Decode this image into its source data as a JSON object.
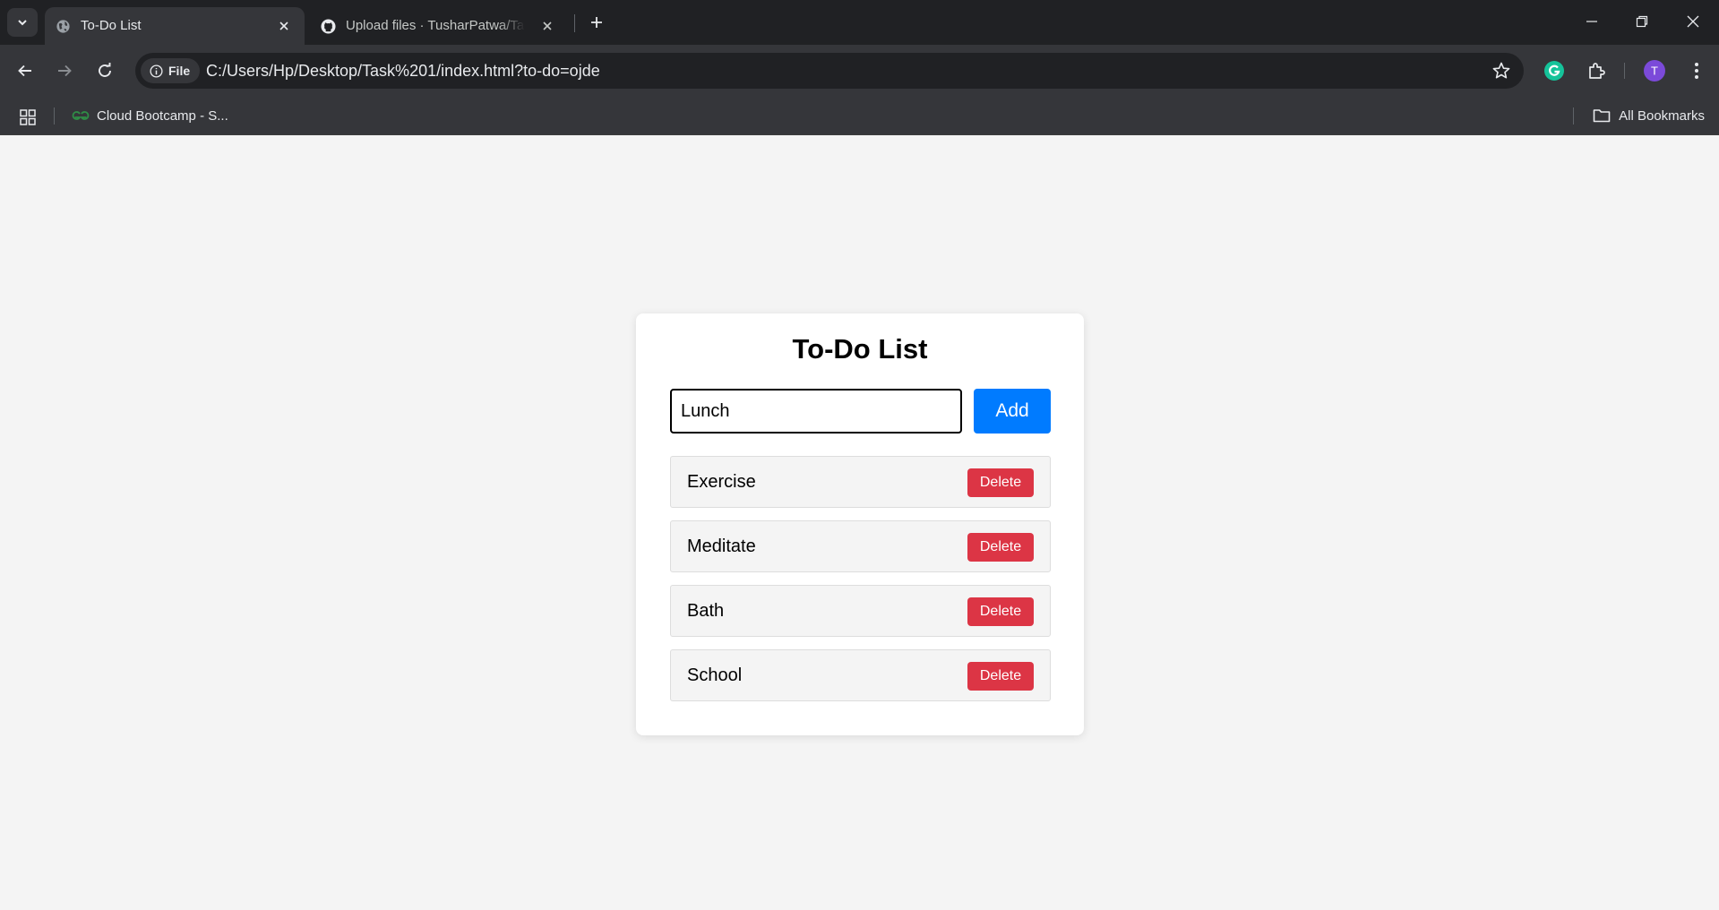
{
  "browser": {
    "tabs": [
      {
        "title": "To-Do List",
        "favicon": "globe-icon",
        "active": true
      },
      {
        "title": "Upload files · TusharPatwa/Task",
        "favicon": "github-icon",
        "active": false
      }
    ],
    "address": {
      "chip_label": "File",
      "url": "C:/Users/Hp/Desktop/Task%201/index.html?to-do=ojde"
    },
    "profile_initial": "T",
    "colors": {
      "profile": "#7b4ad9",
      "grammarly": "#15c39a"
    },
    "bookmarks": {
      "items": [
        {
          "label": "Cloud Bootcamp - S...",
          "icon": "geeksforgeeks-icon"
        }
      ],
      "all_label": "All Bookmarks"
    }
  },
  "app": {
    "heading": "To-Do List",
    "input": {
      "value": "Lunch",
      "placeholder": ""
    },
    "add_label": "Add",
    "tasks": [
      {
        "text": "Exercise",
        "delete_label": "Delete"
      },
      {
        "text": "Meditate",
        "delete_label": "Delete"
      },
      {
        "text": "Bath",
        "delete_label": "Delete"
      },
      {
        "text": "School",
        "delete_label": "Delete"
      }
    ],
    "colors": {
      "add": "#007bff",
      "delete": "#dc3545",
      "card": "#ffffff",
      "background": "#f4f4f4"
    }
  }
}
